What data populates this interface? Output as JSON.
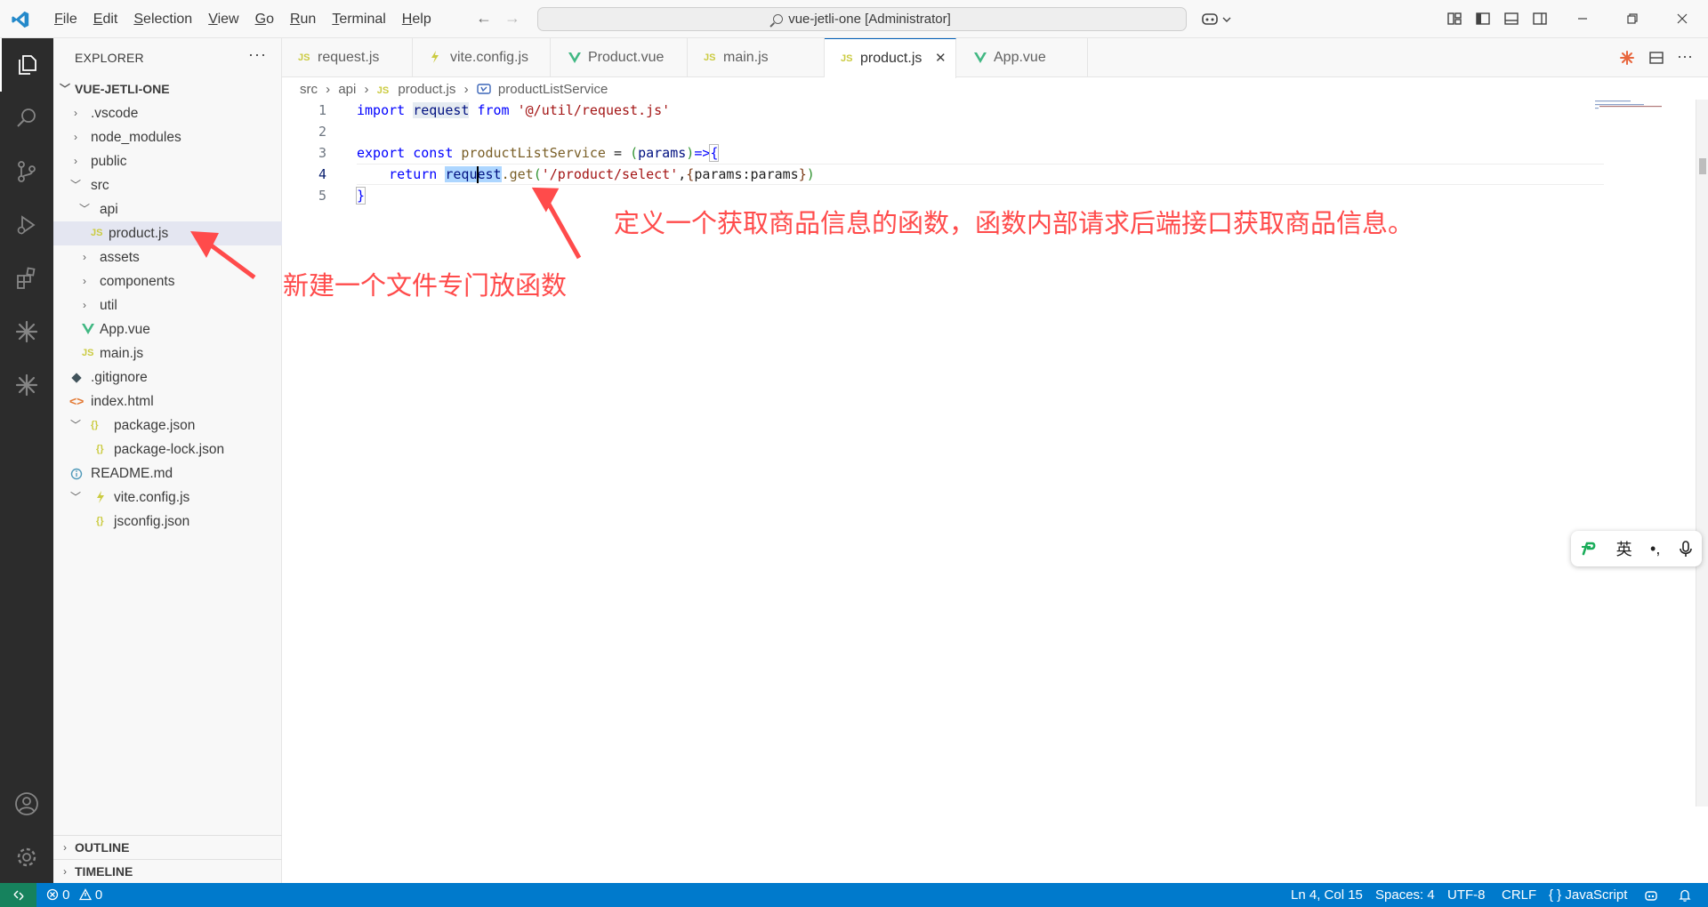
{
  "titlebar": {
    "menu": [
      "File",
      "Edit",
      "Selection",
      "View",
      "Go",
      "Run",
      "Terminal",
      "Help"
    ],
    "command_center": "vue-jetli-one [Administrator]"
  },
  "sidebar": {
    "header": "EXPLORER",
    "more": "···",
    "root": "VUE-JETLI-ONE",
    "items": [
      {
        "label": ".vscode",
        "type": "folder"
      },
      {
        "label": "node_modules",
        "type": "folder"
      },
      {
        "label": "public",
        "type": "folder"
      },
      {
        "label": "src",
        "type": "folder-open"
      },
      {
        "label": "api",
        "type": "folder-open"
      },
      {
        "label": "product.js",
        "type": "js",
        "icon": "JS"
      },
      {
        "label": "assets",
        "type": "folder"
      },
      {
        "label": "components",
        "type": "folder"
      },
      {
        "label": "util",
        "type": "folder"
      },
      {
        "label": "App.vue",
        "type": "vue"
      },
      {
        "label": "main.js",
        "type": "js",
        "icon": "JS"
      },
      {
        "label": ".gitignore",
        "type": "git"
      },
      {
        "label": "index.html",
        "type": "html"
      },
      {
        "label": "package.json",
        "type": "json",
        "icon": "{}"
      },
      {
        "label": "package-lock.json",
        "type": "json",
        "icon": "{}"
      },
      {
        "label": "README.md",
        "type": "info"
      },
      {
        "label": "vite.config.js",
        "type": "vite"
      },
      {
        "label": "jsconfig.json",
        "type": "json",
        "icon": "{}"
      }
    ],
    "outline": "OUTLINE",
    "timeline": "TIMELINE"
  },
  "tabs": [
    {
      "label": "request.js",
      "icon": "JS"
    },
    {
      "label": "vite.config.js",
      "icon": "vite"
    },
    {
      "label": "Product.vue",
      "icon": "vue"
    },
    {
      "label": "main.js",
      "icon": "JS"
    },
    {
      "label": "product.js",
      "icon": "JS",
      "active": true,
      "close": "✕"
    },
    {
      "label": "App.vue",
      "icon": "vue"
    }
  ],
  "breadcrumb": {
    "parts": [
      "src",
      "api",
      "product.js",
      "productListService"
    ],
    "sep": "›",
    "js_icon": "JS"
  },
  "editor": {
    "line_numbers": [
      "1",
      "2",
      "3",
      "4",
      "5"
    ],
    "code": {
      "l1_import": "import",
      "l1_request": "request",
      "l1_from": "from",
      "l1_str": "'@/util/request.js'",
      "l3_export": "export",
      "l3_const": "const",
      "l3_name": "productListService",
      "l3_eq": " = ",
      "l3_open": "(",
      "l3_params": "params",
      "l3_close": ")",
      "l3_arrow": "=>",
      "l3_brace": "{",
      "l4_return": "return",
      "l4_req_a": "req",
      "l4_req_b": "uest",
      "l4_get": ".get",
      "l4_p1": "(",
      "l4_str": "'/product/select'",
      "l4_comma": ",",
      "l4_brace_o": "{",
      "l4_obj": "params:params",
      "l4_brace_c": "}",
      "l4_p2": ")",
      "l5_brace": "}"
    }
  },
  "annotations": {
    "top": "定义一个获取商品信息的函数，函数内部请求后端接口获取商品信息。",
    "left": "新建一个文件专门放函数"
  },
  "ime": {
    "lang": "英",
    "punct": "•,"
  },
  "statusbar": {
    "errors": "0",
    "warnings": "0",
    "position": "Ln 4, Col 15",
    "spaces": "Spaces: 4",
    "encoding": "UTF-8",
    "eol": "CRLF",
    "lang_braces": "{ }",
    "language": "JavaScript"
  },
  "colors": {
    "accent": "#007acc",
    "annotation": "#ff4b4b",
    "activitybar": "#2c2c2c"
  }
}
